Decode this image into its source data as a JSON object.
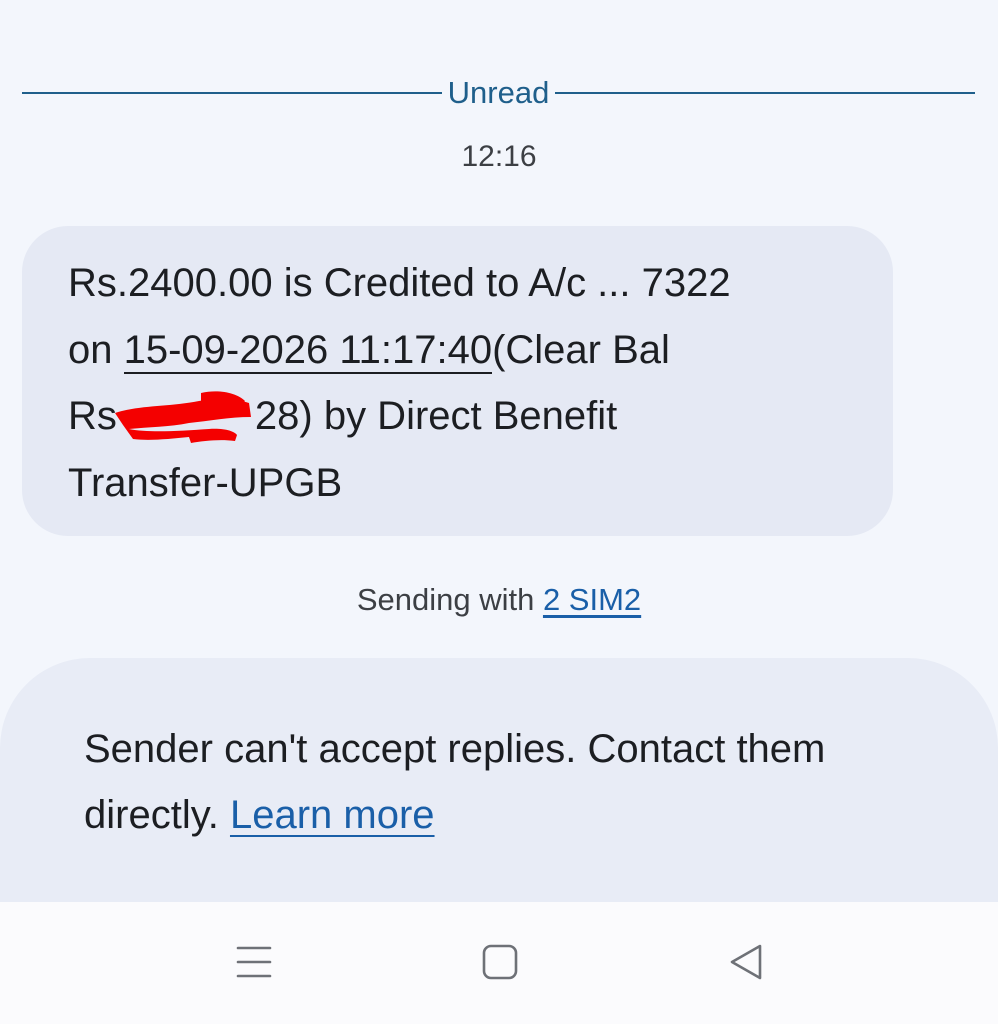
{
  "divider": {
    "label": "Unread"
  },
  "timestamp": "12:16",
  "message": {
    "line1": "Rs.2400.00 is Credited to A/c ... 7322",
    "line2_prefix": "on ",
    "date_link": "15-09-2026 11:17:40",
    "line2_suffix": "(Clear Bal",
    "line3_prefix": "Rs",
    "line3_suffix": "28) by Direct Benefit",
    "line4": "Transfer-UPGB"
  },
  "sending": {
    "prefix": "Sending with ",
    "sim_label": "2 SIM2"
  },
  "notice": {
    "text": "Sender can't accept replies. Contact them directly.",
    "link": "Learn more"
  },
  "navbar": {
    "icons": [
      "menu-icon",
      "home-icon",
      "back-icon"
    ]
  },
  "colors": {
    "accent": "#1a5fa8",
    "divider": "#1f5f8b",
    "bubble": "#e5e9f4",
    "background": "#f3f6fc",
    "redaction": "#f40000"
  }
}
